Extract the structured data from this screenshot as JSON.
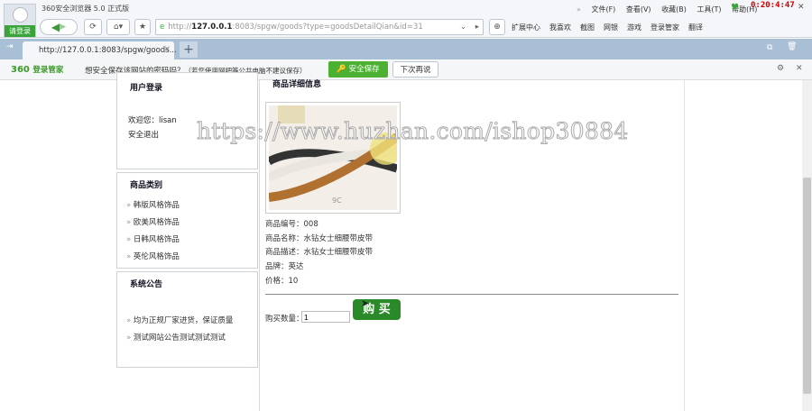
{
  "browser": {
    "title": "360安全浏览器 5.0 正式版",
    "login": "请登录",
    "url_prefix": "http://",
    "url_host": "127.0.0.1",
    "url_rest": ":8083/spgw/goods?type=goodsDetailQian&id=31",
    "menu": [
      "文件(F)",
      "查看(V)",
      "收藏(B)",
      "工具(T)",
      "帮助(H)"
    ],
    "clock": "0:20:4:47",
    "toolbar_items": [
      "扩展中心",
      "我喜欢",
      "截图",
      "网银",
      "游戏",
      "登录管家",
      "翻译"
    ],
    "tab_label": "http://127.0.0.1:8083/spgw/goods...",
    "pwbar": {
      "brand": "360",
      "brand_sub": "登录管家",
      "question": "想安全保存该网站的密码吗？",
      "hint": "（若您使用网吧等公共电脑不建议保存）",
      "save": "安全保存",
      "later": "下次再说"
    }
  },
  "watermark": "https://www.huzhan.com/ishop30884",
  "sidebar": {
    "login_title": "用户登录",
    "welcome": "欢迎您：lisan",
    "logout": "安全退出",
    "category_title": "商品类别",
    "categories": [
      "韩版风格饰品",
      "欧美风格饰品",
      "日韩风格饰品",
      "英伦风格饰品"
    ],
    "notice_title": "系统公告",
    "notices": [
      "均为正规厂家进货，保证质量",
      "测试网站公告测试测试测试"
    ]
  },
  "product": {
    "section_title": "商品详细信息",
    "image_caption": "9C",
    "lines": [
      "商品编号：008",
      "商品名称：水钻女士细腰带皮带",
      "商品描述：水钻女士细腰带皮带",
      "品牌：英达",
      "价格：10"
    ],
    "qty_label": "购买数量：",
    "qty_value": "1",
    "buy": "购 买"
  }
}
